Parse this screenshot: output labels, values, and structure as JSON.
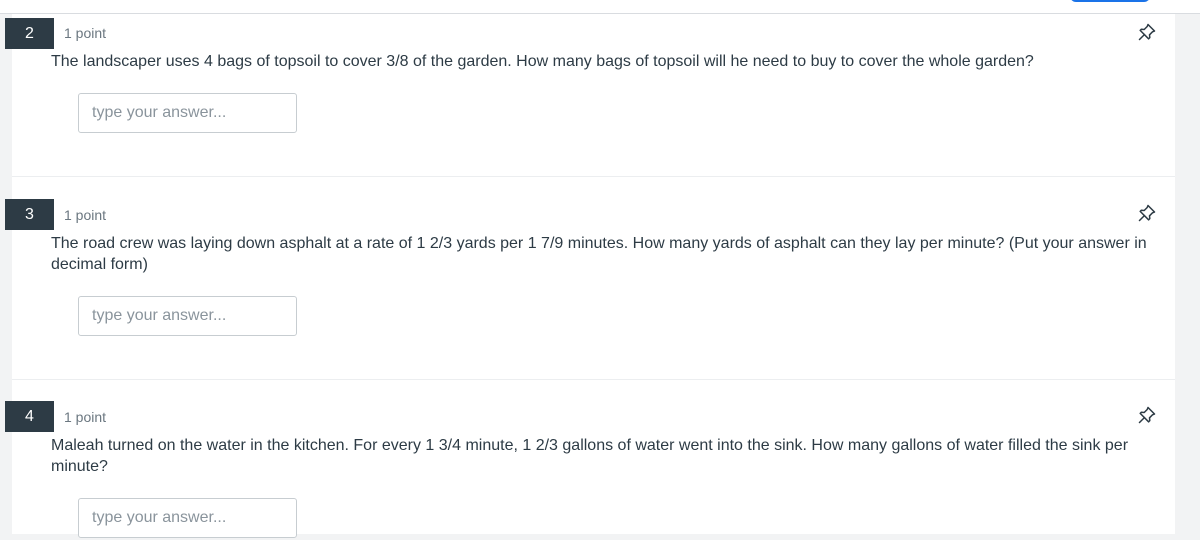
{
  "questions": [
    {
      "number": "2",
      "points": "1 point",
      "text": "The landscaper uses 4 bags of topsoil to cover 3/8 of the garden. How many bags of topsoil will he need to buy to cover the whole garden?",
      "answer_value": "",
      "answer_placeholder": "type your answer..."
    },
    {
      "number": "3",
      "points": "1 point",
      "text": "The road crew was laying down asphalt at a rate of 1  2/3  yards per 1  7/9 minutes. How many yards of asphalt can they lay per minute? (Put your answer in decimal form)",
      "answer_value": "",
      "answer_placeholder": "type your answer..."
    },
    {
      "number": "4",
      "points": "1 point",
      "text": "Maleah turned on the water in the kitchen. For every 1  3/4 minute, 1  2/3 gallons of water went into the sink. How many gallons of water filled the sink per minute?",
      "answer_value": "",
      "answer_placeholder": "type your answer..."
    }
  ],
  "icons": {
    "pin": "pin-icon"
  },
  "colors": {
    "number_badge_bg": "#2d3b45",
    "text": "#2d3b45",
    "points_text": "#6b7780",
    "accent": "#1a73e8"
  }
}
